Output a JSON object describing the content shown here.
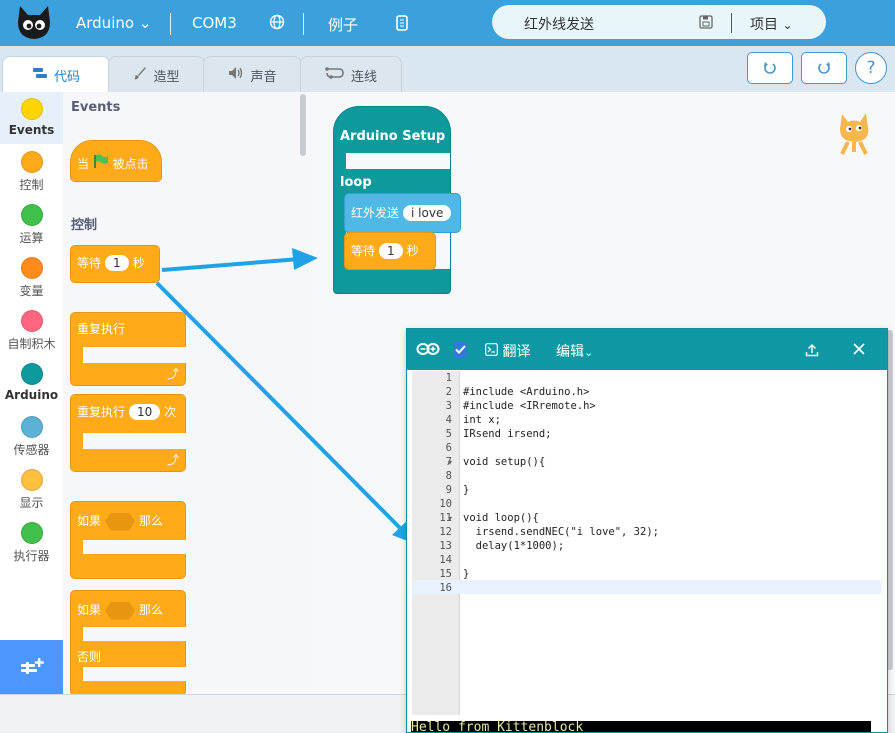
{
  "topbar": {
    "board": "Arduino",
    "port": "COM3",
    "examples": "例子",
    "project_name": "红外线发送",
    "project_menu": "项目"
  },
  "tabs": [
    {
      "label": "代码"
    },
    {
      "label": "造型"
    },
    {
      "label": "声音"
    },
    {
      "label": "连线"
    }
  ],
  "categories": [
    {
      "label": "Events",
      "color": "#ffd500"
    },
    {
      "label": "控制",
      "color": "#ffab19"
    },
    {
      "label": "运算",
      "color": "#40bf4a"
    },
    {
      "label": "变量",
      "color": "#ff8c1a"
    },
    {
      "label": "自制积木",
      "color": "#ff6680"
    },
    {
      "label": "Arduino",
      "color": "#0e9a9c"
    },
    {
      "label": "传感器",
      "color": "#5cb1d6"
    },
    {
      "label": "显示",
      "color": "#ffbf40"
    },
    {
      "label": "执行器",
      "color": "#40bf4a"
    }
  ],
  "palette": {
    "events_heading": "Events",
    "when_flag": {
      "prefix": "当",
      "suffix": "被点击"
    },
    "control_heading": "控制",
    "wait": {
      "prefix": "等待",
      "value": "1",
      "suffix": "秒"
    },
    "repeat_forever": "重复执行",
    "repeat_n": {
      "prefix": "重复执行",
      "value": "10",
      "suffix": "次"
    },
    "if_then": {
      "prefix": "如果",
      "suffix": "那么"
    },
    "if_else": {
      "prefix": "如果",
      "suffix": "那么",
      "else": "否则"
    }
  },
  "workspace": {
    "setup_label": "Arduino Setup",
    "loop_label": "loop",
    "ir_send": {
      "prefix": "红外发送",
      "value": "i love"
    },
    "wait": {
      "prefix": "等待",
      "value": "1",
      "suffix": "秒"
    }
  },
  "code_window": {
    "translate": "翻译",
    "edit": "编辑",
    "line_numbers": [
      "1",
      "2",
      "3",
      "4",
      "5",
      "6",
      "7",
      "8",
      "9",
      "10",
      "11",
      "12",
      "13",
      "14",
      "15",
      "16"
    ],
    "lines": [
      "",
      "#include <Arduino.h>",
      "#include <IRremote.h>",
      "int x;",
      "IRsend irsend;",
      "",
      "void setup(){",
      "",
      "}",
      "",
      "void loop(){",
      "  irsend.sendNEC(\"i love\", 32);",
      "  delay(1*1000);",
      "",
      "}",
      ""
    ],
    "console_text": "Hello from Kittenblock"
  },
  "colors": {
    "topbar": "#3ca0dc",
    "arduino_teal": "#0e9a9c",
    "control_orange": "#ffab19",
    "arrow_blue": "#1fa3e6"
  }
}
